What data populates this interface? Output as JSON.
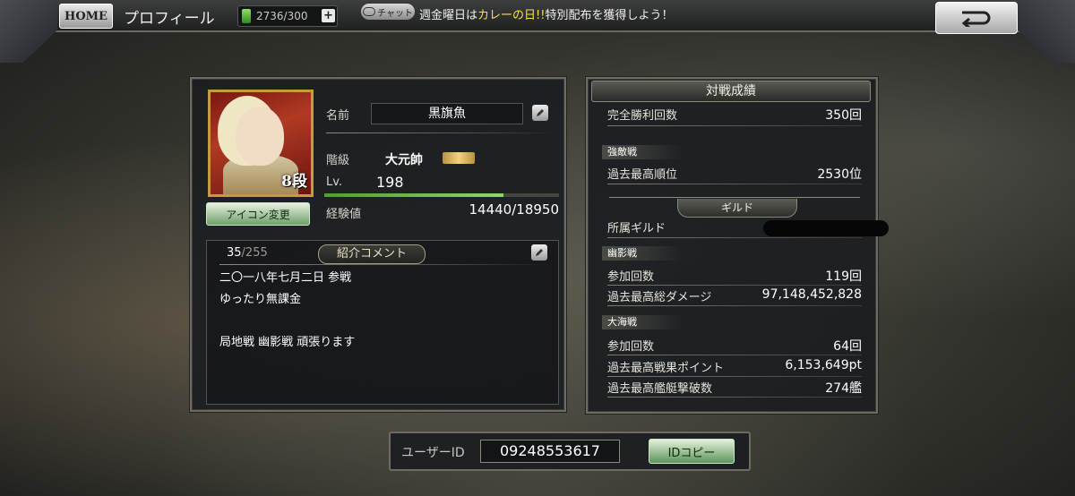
{
  "header": {
    "home_label": "HOME",
    "title": "プロフィール",
    "stamina": "2736/300",
    "chat_label": "チャット",
    "ticker_prefix": "週金曜日は",
    "ticker_highlight": "カレーの日!!",
    "ticker_suffix": "特別配布を獲得しよう！"
  },
  "profile": {
    "rank_badge": "8段",
    "icon_change_label": "アイコン変更",
    "name_label": "名前",
    "name": "黒旗魚",
    "rank_label": "階級",
    "rank": "大元帥",
    "level_label": "Lv.",
    "level": "198",
    "exp_label": "経験値",
    "exp": "14440/18950",
    "exp_fraction": 0.762
  },
  "comment": {
    "count": "35",
    "max": "/255",
    "title": "紹介コメント",
    "lines": [
      "二〇一八年七月二日 参戦",
      "ゆったり無課金",
      "",
      "局地戦 幽影戦 頑張ります"
    ]
  },
  "stats": {
    "title": "対戦成績",
    "perfect_wins_label": "完全勝利回数",
    "perfect_wins": "350回",
    "strong_enemy_section": "強敵戦",
    "best_rank_label": "過去最高順位",
    "best_rank": "2530位",
    "guild_section": "ギルド",
    "guild_label": "所属ギルド",
    "phantom_section": "幽影戦",
    "phantom_participation_label": "参加回数",
    "phantom_participation": "119回",
    "phantom_damage_label": "過去最高総ダメージ",
    "phantom_damage": "97,148,452,828",
    "ocean_section": "大海戦",
    "ocean_participation_label": "参加回数",
    "ocean_participation": "64回",
    "ocean_points_label": "過去最高戦果ポイント",
    "ocean_points": "6,153,649pt",
    "ocean_sunk_label": "過去最高艦艇撃破数",
    "ocean_sunk": "274艦"
  },
  "user_id": {
    "label": "ユーザーID",
    "value": "09248553617",
    "copy_label": "IDコピー"
  }
}
